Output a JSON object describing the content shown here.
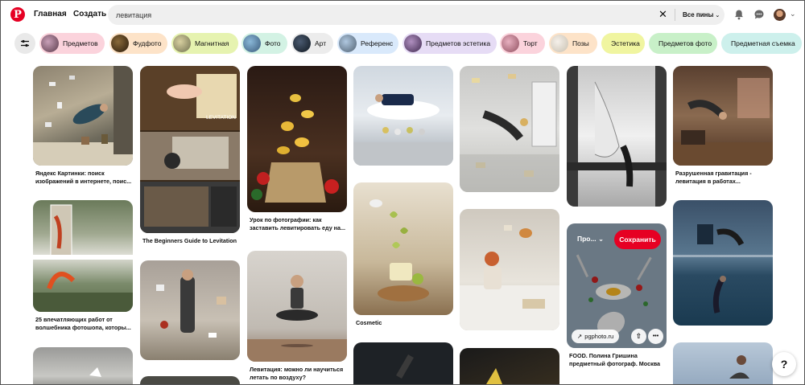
{
  "header": {
    "logo": "P",
    "nav_home": "Главная",
    "nav_create": "Создать",
    "search_value": "левитация",
    "clear_icon": "✕",
    "scope_label": "Все пины",
    "scope_chevron": "⌄",
    "avatar_chevron": "⌄"
  },
  "chips": [
    {
      "label": "Предметов",
      "bg": "#fbd3dc"
    },
    {
      "label": "Фудфото",
      "bg": "#fde3c8"
    },
    {
      "label": "Магнитная",
      "bg": "#e6f3b0"
    },
    {
      "label": "Фото",
      "bg": "#d3f2e4"
    },
    {
      "label": "Арт",
      "bg": "#ececec"
    },
    {
      "label": "Референс",
      "bg": "#d9e9fb"
    },
    {
      "label": "Предметов эстетика",
      "bg": "#e6dcf5"
    },
    {
      "label": "Торт",
      "bg": "#fbd3dc"
    },
    {
      "label": "Позы",
      "bg": "#fde3c8"
    },
    {
      "label": "Эстетика",
      "bg": "#f0f5a0"
    },
    {
      "label": "Предметов фото",
      "bg": "#c8f0c8"
    },
    {
      "label": "Предметная съемка",
      "bg": "#cdf0ec"
    }
  ],
  "pins": {
    "captions": [
      "Яндекс Картинки: поиск изображений в интернете, поис...",
      "25 впечатляющих работ от волшебника фотошопа, которы...",
      "The Beginners Guide to Levitation",
      "Урок по фотографии: как заставить левитировать еду на...",
      "Левитация: можно ли научиться летать по воздуху?",
      "Cosmetic",
      "Разрушенная гравитация - левитация в работах...",
      "FOOD. Полина Гришина предметный фотограф. Москва"
    ],
    "image_text": "LEVITATION",
    "hover": {
      "profile_label": "Про...",
      "save_label": "Сохранить",
      "link_label": "pgphoto.ru",
      "link_icon": "↗",
      "share_icon": "⇧",
      "more_icon": "•••"
    }
  },
  "help_label": "?"
}
